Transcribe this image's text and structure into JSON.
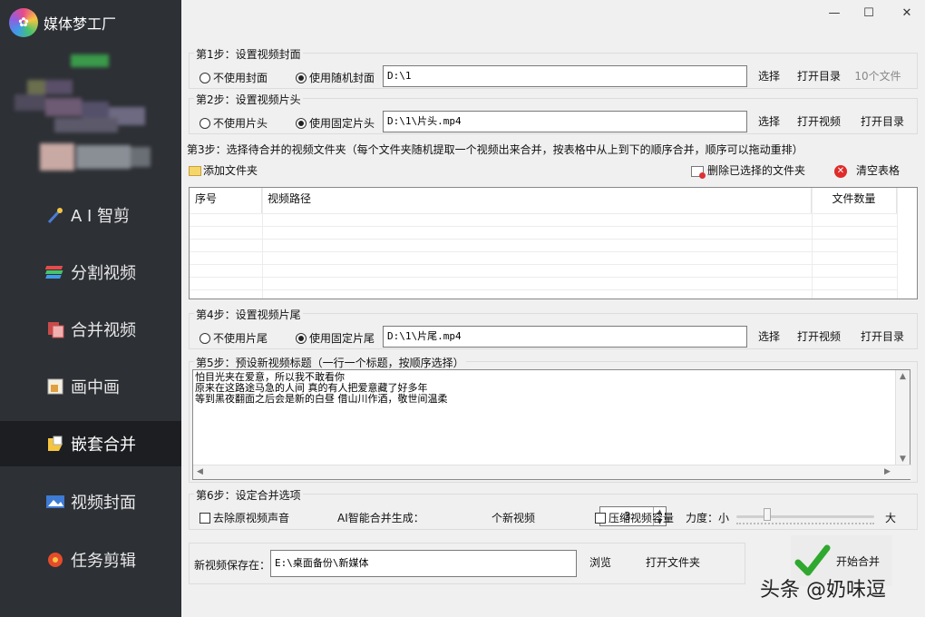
{
  "app": {
    "title": "媒体梦工厂",
    "logo_icon": "flower-logo-icon"
  },
  "sidebar": {
    "items": [
      {
        "label": "A I 智剪",
        "icon": "ai-wand-icon"
      },
      {
        "label": "分割视频",
        "icon": "split-video-icon"
      },
      {
        "label": "合并视频",
        "icon": "merge-video-icon"
      },
      {
        "label": "画中画",
        "icon": "picture-in-picture-icon"
      },
      {
        "label": "嵌套合并",
        "icon": "nested-merge-icon",
        "active": true
      },
      {
        "label": "视频封面",
        "icon": "video-cover-icon"
      },
      {
        "label": "任务剪辑",
        "icon": "task-edit-icon"
      }
    ]
  },
  "window": {
    "minimize": "—",
    "maximize": "☐",
    "close": "✕"
  },
  "step1": {
    "label": "第1步：设置视频封面",
    "opt_none": "不使用封面",
    "opt_random": "使用随机封面",
    "path": "D:\\1",
    "select": "选择",
    "open_dir": "打开目录",
    "count": "10个文件"
  },
  "step2": {
    "label": "第2步：设置视频片头",
    "opt_none": "不使用片头",
    "opt_fixed": "使用固定片头",
    "path": "D:\\1\\片头.mp4",
    "select": "选择",
    "open_video": "打开视频",
    "open_dir": "打开目录"
  },
  "step3": {
    "label": "第3步：选择待合并的视频文件夹（每个文件夹随机提取一个视频出来合并，按表格中从上到下的顺序合并，顺序可以拖动重排）",
    "add_folder": "添加文件夹",
    "delete_selected": "删除已选择的文件夹",
    "clear_table": "清空表格",
    "table": {
      "columns": [
        "序号",
        "视频路径",
        "文件数量"
      ],
      "rows": []
    }
  },
  "step4": {
    "label": "第4步：设置视频片尾",
    "opt_none": "不使用片尾",
    "opt_fixed": "使用固定片尾",
    "path": "D:\\1\\片尾.mp4",
    "select": "选择",
    "open_video": "打开视频",
    "open_dir": "打开目录"
  },
  "step5": {
    "label": "第5步：预设新视频标题（一行一个标题，按顺序选择）",
    "lines": [
      "怕目光夹在爱意，所以我不敢看你",
      "原来在这路途马急的人间 真的有人把爱意藏了好多年",
      "等到黑夜翻面之后会是新的白昼 借山川作酒，敬世间温柔"
    ]
  },
  "step6": {
    "label": "第6步：设定合并选项",
    "remove_audio": "去除原视频声音",
    "ai_label": "AI智能合并生成：",
    "ai_value": "3",
    "ai_unit": "个新视频",
    "compress": "压缩视频容量",
    "strength": "力度：小",
    "strength_max": "大"
  },
  "save": {
    "label": "新视频保存在：",
    "path": "E:\\桌面备份\\新媒体",
    "browse": "浏览",
    "open_folder": "打开文件夹"
  },
  "start_button": "开始合并",
  "watermark": "头条 @奶味逗",
  "colors": {
    "sidebar_bg": "#2d3035",
    "sidebar_active": "#1c1e21",
    "panel_bg": "#f0f0f0"
  }
}
